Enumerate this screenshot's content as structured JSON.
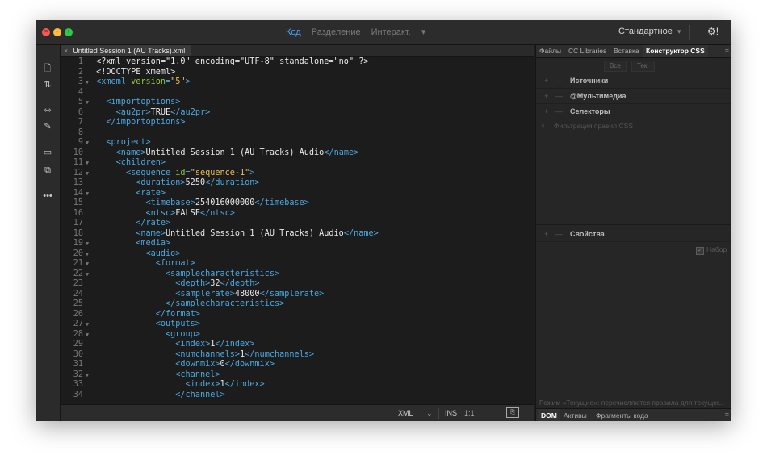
{
  "titlebar": {
    "modes": [
      "Код",
      "Разделение",
      "Интеракт."
    ],
    "active_mode": "Код",
    "layout": "Стандартное",
    "settings_icon": "gear-icon"
  },
  "toolbar": {
    "tools": [
      "file-icon",
      "sort-icon",
      "link-icon",
      "wand-icon",
      "comment-icon",
      "preview-icon",
      "more-icon"
    ]
  },
  "editor": {
    "tab": {
      "label": "Untitled Session 1 (AU Tracks).xml"
    },
    "lines": [
      {
        "n": "1",
        "fold": false,
        "indent": 0,
        "tokens": [
          {
            "t": "txt",
            "v": "<?xml version=\"1.0\" encoding=\"UTF-8\" standalone=\"no\" ?>"
          }
        ]
      },
      {
        "n": "2",
        "fold": false,
        "indent": 0,
        "tokens": [
          {
            "t": "txt",
            "v": "<!DOCTYPE xmeml>"
          }
        ]
      },
      {
        "n": "3",
        "fold": true,
        "indent": 0,
        "tokens": [
          {
            "t": "tag",
            "v": "<xmeml"
          },
          {
            "t": "attr",
            "v": " version"
          },
          {
            "t": "tag",
            "v": "="
          },
          {
            "t": "val",
            "v": "\"5\""
          },
          {
            "t": "tag",
            "v": ">"
          }
        ]
      },
      {
        "n": "4",
        "fold": false,
        "indent": 0,
        "tokens": []
      },
      {
        "n": "5",
        "fold": true,
        "indent": 1,
        "tokens": [
          {
            "t": "tag",
            "v": "<importoptions>"
          }
        ]
      },
      {
        "n": "6",
        "fold": false,
        "indent": 2,
        "tokens": [
          {
            "t": "tag",
            "v": "<au2pr>"
          },
          {
            "t": "txt",
            "v": "TRUE"
          },
          {
            "t": "tag",
            "v": "</au2pr>"
          }
        ]
      },
      {
        "n": "7",
        "fold": false,
        "indent": 1,
        "tokens": [
          {
            "t": "tag",
            "v": "</importoptions>"
          }
        ]
      },
      {
        "n": "8",
        "fold": false,
        "indent": 0,
        "tokens": []
      },
      {
        "n": "9",
        "fold": true,
        "indent": 1,
        "tokens": [
          {
            "t": "tag",
            "v": "<project>"
          }
        ]
      },
      {
        "n": "10",
        "fold": false,
        "indent": 2,
        "tokens": [
          {
            "t": "tag",
            "v": "<name>"
          },
          {
            "t": "txt",
            "v": "Untitled Session 1 (AU Tracks) Audio"
          },
          {
            "t": "tag",
            "v": "</name>"
          }
        ]
      },
      {
        "n": "11",
        "fold": true,
        "indent": 2,
        "tokens": [
          {
            "t": "tag",
            "v": "<children>"
          }
        ]
      },
      {
        "n": "12",
        "fold": true,
        "indent": 3,
        "tokens": [
          {
            "t": "tag",
            "v": "<sequence"
          },
          {
            "t": "attr",
            "v": " id"
          },
          {
            "t": "tag",
            "v": "="
          },
          {
            "t": "val",
            "v": "\"sequence-1\""
          },
          {
            "t": "tag",
            "v": ">"
          }
        ]
      },
      {
        "n": "13",
        "fold": false,
        "indent": 4,
        "tokens": [
          {
            "t": "tag",
            "v": "<duration>"
          },
          {
            "t": "txt",
            "v": "5250"
          },
          {
            "t": "tag",
            "v": "</duration>"
          }
        ]
      },
      {
        "n": "14",
        "fold": true,
        "indent": 4,
        "tokens": [
          {
            "t": "tag",
            "v": "<rate>"
          }
        ]
      },
      {
        "n": "15",
        "fold": false,
        "indent": 5,
        "tokens": [
          {
            "t": "tag",
            "v": "<timebase>"
          },
          {
            "t": "txt",
            "v": "254016000000"
          },
          {
            "t": "tag",
            "v": "</timebase>"
          }
        ]
      },
      {
        "n": "16",
        "fold": false,
        "indent": 5,
        "tokens": [
          {
            "t": "tag",
            "v": "<ntsc>"
          },
          {
            "t": "txt",
            "v": "FALSE"
          },
          {
            "t": "tag",
            "v": "</ntsc>"
          }
        ]
      },
      {
        "n": "17",
        "fold": false,
        "indent": 4,
        "tokens": [
          {
            "t": "tag",
            "v": "</rate>"
          }
        ]
      },
      {
        "n": "18",
        "fold": false,
        "indent": 4,
        "tokens": [
          {
            "t": "tag",
            "v": "<name>"
          },
          {
            "t": "txt",
            "v": "Untitled Session 1 (AU Tracks) Audio"
          },
          {
            "t": "tag",
            "v": "</name>"
          }
        ]
      },
      {
        "n": "19",
        "fold": true,
        "indent": 4,
        "tokens": [
          {
            "t": "tag",
            "v": "<media>"
          }
        ]
      },
      {
        "n": "20",
        "fold": true,
        "indent": 5,
        "tokens": [
          {
            "t": "tag",
            "v": "<audio>"
          }
        ]
      },
      {
        "n": "21",
        "fold": true,
        "indent": 6,
        "tokens": [
          {
            "t": "tag",
            "v": "<format>"
          }
        ]
      },
      {
        "n": "22",
        "fold": true,
        "indent": 7,
        "tokens": [
          {
            "t": "tag",
            "v": "<samplecharacteristics>"
          }
        ]
      },
      {
        "n": "23",
        "fold": false,
        "indent": 8,
        "tokens": [
          {
            "t": "tag",
            "v": "<depth>"
          },
          {
            "t": "txt",
            "v": "32"
          },
          {
            "t": "tag",
            "v": "</depth>"
          }
        ]
      },
      {
        "n": "24",
        "fold": false,
        "indent": 8,
        "tokens": [
          {
            "t": "tag",
            "v": "<samplerate>"
          },
          {
            "t": "txt",
            "v": "48000"
          },
          {
            "t": "tag",
            "v": "</samplerate>"
          }
        ]
      },
      {
        "n": "25",
        "fold": false,
        "indent": 7,
        "tokens": [
          {
            "t": "tag",
            "v": "</samplecharacteristics>"
          }
        ]
      },
      {
        "n": "26",
        "fold": false,
        "indent": 6,
        "tokens": [
          {
            "t": "tag",
            "v": "</format>"
          }
        ]
      },
      {
        "n": "27",
        "fold": true,
        "indent": 6,
        "tokens": [
          {
            "t": "tag",
            "v": "<outputs>"
          }
        ]
      },
      {
        "n": "28",
        "fold": true,
        "indent": 7,
        "tokens": [
          {
            "t": "tag",
            "v": "<group>"
          }
        ]
      },
      {
        "n": "29",
        "fold": false,
        "indent": 8,
        "tokens": [
          {
            "t": "tag",
            "v": "<index>"
          },
          {
            "t": "txt",
            "v": "1"
          },
          {
            "t": "tag",
            "v": "</index>"
          }
        ]
      },
      {
        "n": "30",
        "fold": false,
        "indent": 8,
        "tokens": [
          {
            "t": "tag",
            "v": "<numchannels>"
          },
          {
            "t": "txt",
            "v": "1"
          },
          {
            "t": "tag",
            "v": "</numchannels>"
          }
        ]
      },
      {
        "n": "31",
        "fold": false,
        "indent": 8,
        "tokens": [
          {
            "t": "tag",
            "v": "<downmix>"
          },
          {
            "t": "txt",
            "v": "0"
          },
          {
            "t": "tag",
            "v": "</downmix>"
          }
        ]
      },
      {
        "n": "32",
        "fold": true,
        "indent": 8,
        "tokens": [
          {
            "t": "tag",
            "v": "<channel>"
          }
        ]
      },
      {
        "n": "33",
        "fold": false,
        "indent": 9,
        "tokens": [
          {
            "t": "tag",
            "v": "<index>"
          },
          {
            "t": "txt",
            "v": "1"
          },
          {
            "t": "tag",
            "v": "</index>"
          }
        ]
      },
      {
        "n": "34",
        "fold": false,
        "indent": 8,
        "tokens": [
          {
            "t": "tag",
            "v": "</channel>"
          }
        ]
      }
    ],
    "status": {
      "language": "XML",
      "mode": "INS",
      "position": "1:1"
    }
  },
  "panel": {
    "tabs": [
      "Файлы",
      "CC Libraries",
      "Вставка",
      "Конструктор CSS"
    ],
    "active_tab": "Конструктор CSS",
    "buttons": [
      "Все",
      "Тек."
    ],
    "sections": [
      "Источники",
      "@Мультимедиа",
      "Селекторы"
    ],
    "filter_placeholder": "Фильтрация правил CSS",
    "properties_label": "Свойства",
    "checkbox_label": "Набор",
    "note": "Режим «Текущие»: перечисляются правила для текущег...",
    "bottom_tabs": [
      "DOM",
      "Активы",
      "Фрагменты кода"
    ],
    "active_bottom_tab": "DOM"
  },
  "colors": {
    "tag": "#4aa8e0",
    "attribute": "#8ec740",
    "value": "#e8c05a",
    "text": "#e8e8e8",
    "accent": "#4aa3ff"
  }
}
